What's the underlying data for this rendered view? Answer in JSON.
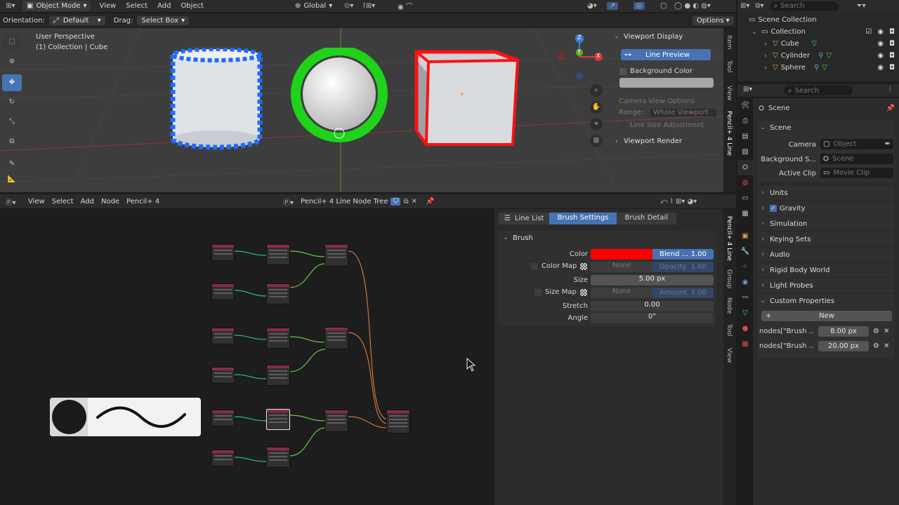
{
  "viewport_header": {
    "mode": "Object Mode",
    "menus": [
      "View",
      "Select",
      "Add",
      "Object"
    ],
    "transform": "Global",
    "search_placeholder": "Search"
  },
  "tool_header": {
    "orientation_label": "Orientation:",
    "orientation_value": "Default",
    "drag_label": "Drag:",
    "drag_value": "Select Box",
    "options": "Options"
  },
  "viewport": {
    "view_name": "User Perspective",
    "context": "(1) Collection | Cube",
    "axes": {
      "z": "Z",
      "y": "Y",
      "x": "X"
    },
    "colors": {
      "cylinder_outline": "#1f6bff",
      "sphere_outline": "#1fd21a",
      "cube_outline": "#ff1010"
    }
  },
  "viewport_panel": {
    "title": "Viewport Display",
    "line_preview": "Line Preview",
    "background_color": "Background Color",
    "camera_view_options": "Camera View Options",
    "range_label": "Range:",
    "range_value": "Whole Viewport",
    "line_size_adjustment": "Line Size Adjustment",
    "viewport_render": "Viewport Render",
    "side_tabs": [
      "Item",
      "Tool",
      "View",
      "Pencil+ 4 Line"
    ]
  },
  "outliner": {
    "search_placeholder": "Search",
    "scene_collection": "Scene Collection",
    "collection": "Collection",
    "items": [
      "Cube",
      "Cylinder",
      "Sphere"
    ]
  },
  "properties": {
    "search_placeholder": "Search",
    "breadcrumb": "Scene",
    "scene_section": "Scene",
    "camera_label": "Camera",
    "camera_value": "Object",
    "background_label": "Background S...",
    "background_value": "Scene",
    "active_clip_label": "Active Clip",
    "active_clip_value": "Movie Clip",
    "sections": [
      "Units",
      "Gravity",
      "Simulation",
      "Keying Sets",
      "Audio",
      "Rigid Body World",
      "Light Probes"
    ],
    "custom_properties": "Custom Properties",
    "new_button": "New",
    "custom_props": [
      {
        "name": "nodes[\"Brush ...",
        "value": "8.00 px"
      },
      {
        "name": "nodes[\"Brush ...",
        "value": "20.00 px"
      }
    ]
  },
  "node_editor": {
    "menus": [
      "View",
      "Select",
      "Add",
      "Node",
      "Pencil+ 4"
    ],
    "tree_name": "Pencil+ 4 Line Node Tree"
  },
  "brush_panel": {
    "tabs": [
      "Line List",
      "Brush Settings",
      "Brush Detail"
    ],
    "active_tab": "Brush Settings",
    "section": "Brush",
    "color_label": "Color",
    "color_hex": "#ff0000",
    "blend_label": "Blend ...",
    "blend_value": "1.00",
    "color_map_label": "Color Map",
    "none1": "None",
    "opacity_label": "Opacity",
    "opacity_value": "1.00",
    "size_label": "Size",
    "size_value": "5.00 px",
    "size_map_label": "Size Map",
    "none2": "None",
    "amount_label": "Amount",
    "amount_value": "1.00",
    "stretch_label": "Stretch",
    "stretch_value": "0.00",
    "angle_label": "Angle",
    "angle_value": "0°",
    "side_tabs": [
      "Pencil+ 4 Line",
      "Group",
      "Node",
      "Tool",
      "View"
    ]
  }
}
